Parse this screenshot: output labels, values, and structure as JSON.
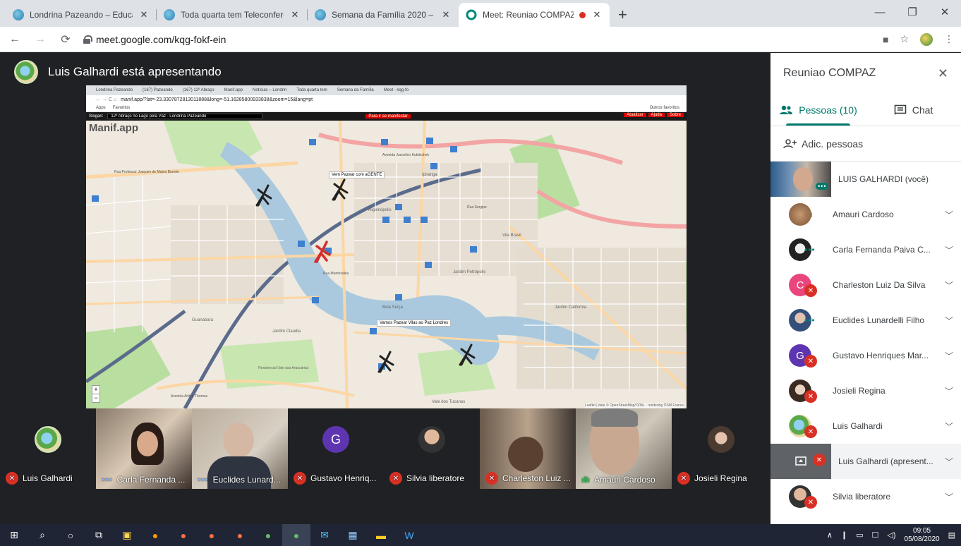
{
  "browser": {
    "tabs": [
      {
        "title": "Londrina Pazeando – Educar para",
        "close": "✕"
      },
      {
        "title": "Toda quarta tem Teleconferência",
        "close": "✕"
      },
      {
        "title": "Semana da Família 2020 – Londri",
        "close": "✕"
      },
      {
        "title": "Meet: Reuniao COMPAZ",
        "close": "✕"
      }
    ],
    "new_tab": "+",
    "url": "meet.google.com/kqg-fokf-ein"
  },
  "presenter_banner": "Luis Galhardi está apresentando",
  "shared_screen": {
    "tabs": [
      "Londrina Pazeando",
      "(167) Pazeando",
      "(167) 12º Abraço",
      "Manif.app",
      "Notícias – Londrin",
      "Toda quarta tem",
      "Semana da Família",
      "Meet - kqg-fo"
    ],
    "url": "manif.app/?lat=-23.3307872813011888&long=-51.16285800933838&zoom=15&lang=pt",
    "bookmarks": [
      "Apps",
      "Favoritos",
      "Outros favoritos"
    ],
    "slogan_label": "Slogan:",
    "slogan": "12º Abraço no Lago pela Paz - Londrina Pazeando",
    "action_button": "Para ir se manifestar",
    "right_buttons": [
      "Atualizar",
      "Ajuda",
      "Sobre"
    ],
    "brand": "Manif.app",
    "map_labels": [
      {
        "text": "Vem Pazear com aGENTE"
      },
      {
        "text": "Vamos Pazear Vilas ao Paz Londres"
      },
      {
        "text": "Avenida Juscelino Kubitschek"
      },
      {
        "text": "Rua Professor Joaquim de Matos Barreto"
      },
      {
        "text": "Rua Montevidéu"
      },
      {
        "text": "Bela Suíça"
      },
      {
        "text": "Jardim Claudia"
      },
      {
        "text": "Guanabara"
      },
      {
        "text": "Vila Brasil"
      },
      {
        "text": "Rua Sergipe"
      },
      {
        "text": "Vale dos Tucanos"
      },
      {
        "text": "Jardim California"
      },
      {
        "text": "Jardim Petrópolis"
      },
      {
        "text": "Higienópolis"
      },
      {
        "text": "Ipiranga"
      },
      {
        "text": "Residencial Vale das Araucárias"
      },
      {
        "text": "Avenida Arthur Thomas"
      }
    ],
    "attribution": "Leaflet | data © OpenStreetMap/ODbL - rendering OSM France",
    "zoom_in": "+",
    "zoom_out": "−"
  },
  "tiles": [
    {
      "name": "Luis Galhardi",
      "status": "muted",
      "kind": "globe"
    },
    {
      "name": "Carla Fernanda ...",
      "status": "dots",
      "kind": "photo"
    },
    {
      "name": "Euclides Lunard...",
      "status": "dots",
      "kind": "photo"
    },
    {
      "name": "Gustavo Henriq...",
      "status": "muted",
      "kind": "letter",
      "letter": "G",
      "color": "#5e35b1"
    },
    {
      "name": "Silvia liberatore",
      "status": "muted",
      "kind": "avatar"
    },
    {
      "name": "Charleston Luiz ...",
      "status": "muted",
      "kind": "photo"
    },
    {
      "name": "Amauri Cardoso",
      "status": "speaking",
      "kind": "photo"
    },
    {
      "name": "Josieli Regina",
      "status": "muted",
      "kind": "avatar"
    }
  ],
  "panel": {
    "title": "Reuniao COMPAZ",
    "tab_people": "Pessoas (10)",
    "tab_chat": "Chat",
    "add_people": "Adic. pessoas",
    "participants": [
      {
        "name": "LUIS GALHARDI (você)",
        "status": "dots",
        "avatar": "video"
      },
      {
        "name": "Amauri Cardoso",
        "status": "speaking",
        "avatar": "photo"
      },
      {
        "name": "Carla Fernanda Paiva C...",
        "status": "dots",
        "avatar": "photo"
      },
      {
        "name": "Charleston Luiz Da Silva",
        "status": "muted",
        "avatar": "letter",
        "letter": "C",
        "color": "#e8467c"
      },
      {
        "name": "Euclides Lunardelli Filho",
        "status": "dots",
        "avatar": "photo"
      },
      {
        "name": "Gustavo Henriques Mar...",
        "status": "muted",
        "avatar": "letter",
        "letter": "G",
        "color": "#5e35b1"
      },
      {
        "name": "Josieli Regina",
        "status": "muted",
        "avatar": "photo"
      },
      {
        "name": "Luis Galhardi",
        "status": "muted",
        "avatar": "globe"
      },
      {
        "name": "Luis Galhardi (apresent...",
        "status": "muted",
        "avatar": "present"
      },
      {
        "name": "Silvia liberatore",
        "status": "muted",
        "avatar": "photo"
      }
    ]
  },
  "taskbar": {
    "time": "09:05",
    "date": "05/08/2020"
  },
  "colors": {
    "meet_dark": "#202124",
    "muted_red": "#d93025",
    "accent_teal": "#00796b",
    "taskbar": "#1f2535"
  }
}
